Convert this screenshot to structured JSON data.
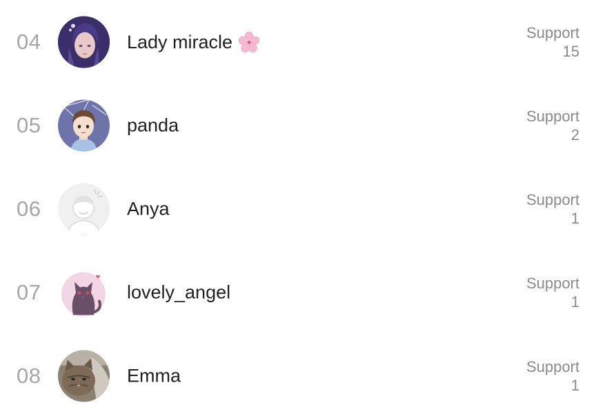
{
  "support_list": {
    "items": [
      {
        "rank": "04",
        "name": "Lady miracle",
        "support_label": "Support",
        "support_count": "15",
        "avatar_icon": "anime-girl-avatar",
        "name_badge_icon": "cherry-blossom-icon"
      },
      {
        "rank": "05",
        "name": "panda",
        "support_label": "Support",
        "support_count": "2",
        "avatar_icon": "cartoon-boy-avatar"
      },
      {
        "rank": "06",
        "name": "Anya",
        "support_label": "Support",
        "support_count": "1",
        "avatar_icon": "default-user-avatar"
      },
      {
        "rank": "07",
        "name": "lovely_angel",
        "support_label": "Support",
        "support_count": "1",
        "avatar_icon": "cat-avatar"
      },
      {
        "rank": "08",
        "name": "Emma",
        "support_label": "Support",
        "support_count": "1",
        "avatar_icon": "cat-photo-avatar"
      }
    ]
  },
  "colors": {
    "rank_text": "#a6a6a6",
    "name_text": "#1f1f1f",
    "support_text": "#8a8a8a",
    "background": "#ffffff"
  }
}
